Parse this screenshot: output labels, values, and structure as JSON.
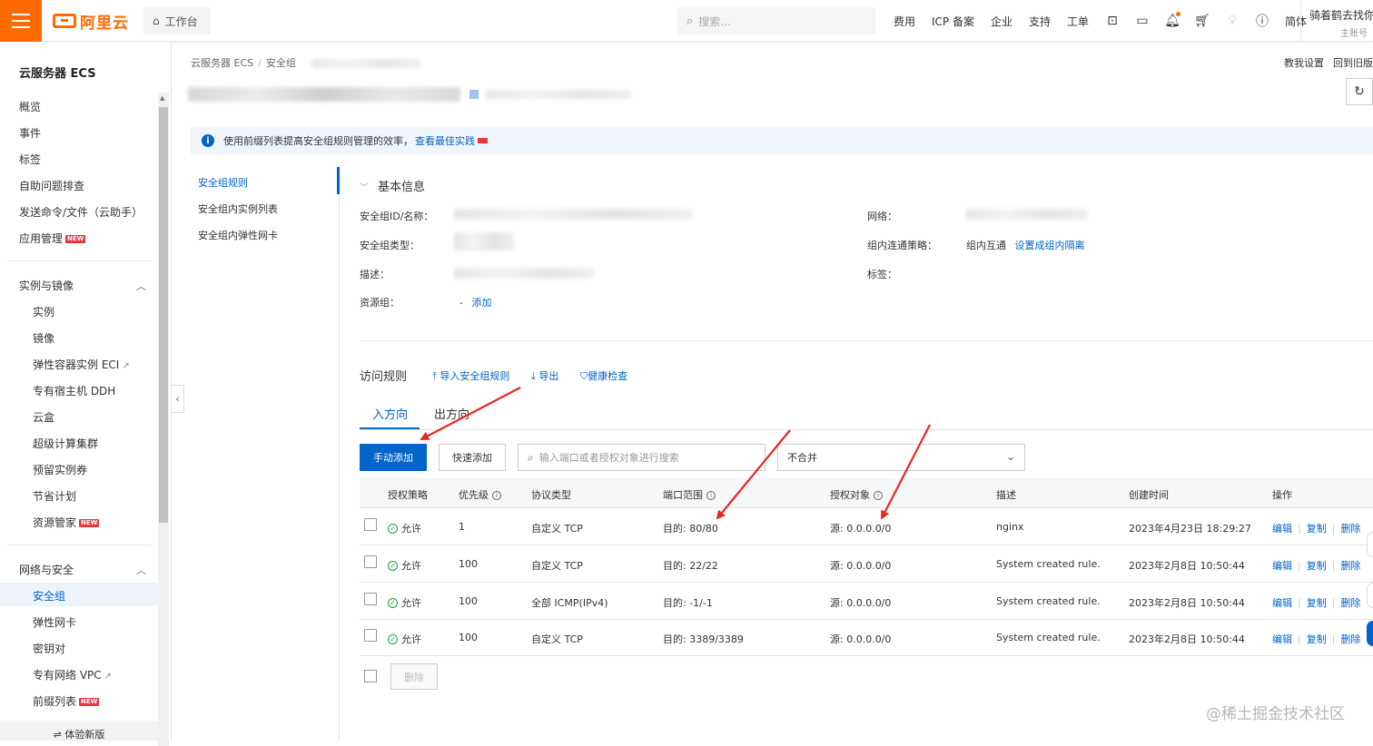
{
  "topbar": {
    "brand": "阿里云",
    "workbench": "工作台",
    "search_placeholder": "搜索...",
    "nav": [
      "费用",
      "ICP 备案",
      "企业",
      "支持",
      "工单"
    ],
    "lang": "简体",
    "user_name": "骑着鹤去找你",
    "user_role": "主账号"
  },
  "sidebar": {
    "title": "云服务器 ECS",
    "top_items": [
      "概览",
      "事件",
      "标签",
      "自助问题排查",
      "发送命令/文件（云助手）",
      "应用管理"
    ],
    "new_badge": "NEW",
    "group1": "实例与镜像",
    "group1_items": [
      "实例",
      "镜像",
      "弹性容器实例 ECI",
      "专有宿主机 DDH",
      "云盒",
      "超级计算集群",
      "预留实例券",
      "节省计划",
      "资源管家"
    ],
    "group2": "网络与安全",
    "group2_items": [
      "安全组",
      "弹性网卡",
      "密钥对",
      "专有网络 VPC",
      "前缀列表"
    ],
    "bottom": "体验新版"
  },
  "breadcrumb": [
    "云服务器 ECS",
    "安全组"
  ],
  "header_links": [
    "教我设置",
    "回到旧版"
  ],
  "notice": {
    "text": "使用前缀列表提高安全组规则管理的效率，",
    "link": "查看最佳实践"
  },
  "subnav": [
    "安全组规则",
    "安全组内实例列表",
    "安全组内弹性网卡"
  ],
  "basic": {
    "title": "基本信息",
    "id_label": "安全组ID/名称：",
    "type_label": "安全组类型：",
    "desc_label": "描述：",
    "rg_label": "资源组：",
    "rg_dash": "-",
    "rg_add": "添加",
    "net_label": "网络：",
    "policy_label": "组内连通策略：",
    "policy_value": "组内互通",
    "policy_link": "设置成组内隔离",
    "tag_label": "标签："
  },
  "rules": {
    "title": "访问规则",
    "import": "导入安全组规则",
    "export": "导出",
    "health": "健康检查",
    "tab_in": "入方向",
    "tab_out": "出方向",
    "btn_manual": "手动添加",
    "btn_quick": "快速添加",
    "search_placeholder": "输入端口或者授权对象进行搜索",
    "merge_select": "不合并",
    "columns": [
      "授权策略",
      "优先级",
      "协议类型",
      "端口范围",
      "授权对象",
      "描述",
      "创建时间",
      "操作"
    ],
    "rows": [
      {
        "policy": "允许",
        "priority": "1",
        "protocol": "自定义 TCP",
        "port": "目的: 80/80",
        "source": "源: 0.0.0.0/0",
        "desc": "nginx",
        "created": "2023年4月23日 18:29:27"
      },
      {
        "policy": "允许",
        "priority": "100",
        "protocol": "自定义 TCP",
        "port": "目的: 22/22",
        "source": "源: 0.0.0.0/0",
        "desc": "System created rule.",
        "created": "2023年2月8日 10:50:44"
      },
      {
        "policy": "允许",
        "priority": "100",
        "protocol": "全部 ICMP(IPv4)",
        "port": "目的: -1/-1",
        "source": "源: 0.0.0.0/0",
        "desc": "System created rule.",
        "created": "2023年2月8日 10:50:44"
      },
      {
        "policy": "允许",
        "priority": "100",
        "protocol": "自定义 TCP",
        "port": "目的: 3389/3389",
        "source": "源: 0.0.0.0/0",
        "desc": "System created rule.",
        "created": "2023年2月8日 10:50:44"
      }
    ],
    "ops": [
      "编辑",
      "复制",
      "删除"
    ],
    "footer_delete": "删除"
  },
  "watermark": "@稀土掘金技术社区",
  "colors": {
    "brand": "#ff6a00",
    "link": "#0064c8",
    "annotation": "#e8281e",
    "allow": "#1aa33a"
  }
}
